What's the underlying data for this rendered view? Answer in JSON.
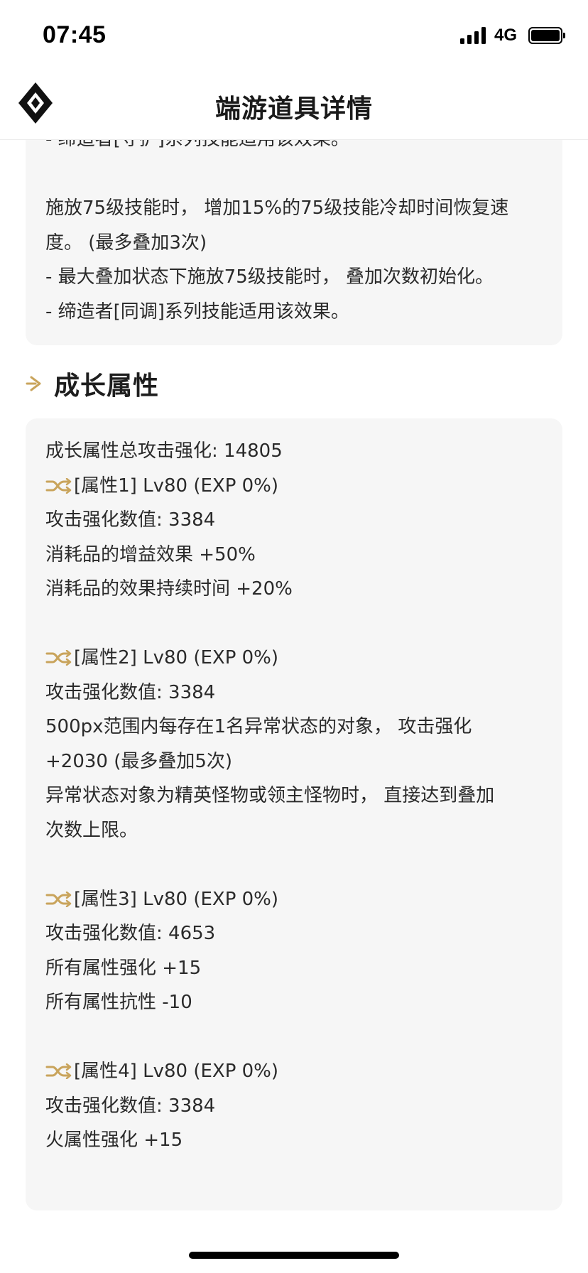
{
  "status_bar": {
    "time": "07:45",
    "network": "4G"
  },
  "header": {
    "title": "端游道具详情",
    "logo_icon": "diamond-logo-icon"
  },
  "top_card": {
    "lines": [
      "- 缔造者[守护]系列技能适用该效果。",
      "",
      "施放75级技能时， 增加15%的75级技能冷却时间恢复速",
      "度。 (最多叠加3次)",
      "- 最大叠加状态下施放75级技能时， 叠加次数初始化。",
      "- 缔造者[同调]系列技能适用该效果。"
    ]
  },
  "growth_section": {
    "title": "成长属性",
    "icon": "arrow-right-icon",
    "accent_color": "#c9a45c",
    "total": "成长属性总攻击强化: 14805",
    "attributes": [
      {
        "header": "[属性1] Lv80 (EXP 0%)",
        "lines": [
          "攻击强化数值:  3384",
          "消耗品的增益效果 +50%",
          "消耗品的效果持续时间 +20%"
        ]
      },
      {
        "header": "[属性2] Lv80 (EXP 0%)",
        "lines": [
          "攻击强化数值:  3384",
          "500px范围内每存在1名异常状态的对象，  攻击强化",
          "+2030 (最多叠加5次)",
          "异常状态对象为精英怪物或领主怪物时，  直接达到叠加",
          "次数上限。"
        ]
      },
      {
        "header": "[属性3] Lv80 (EXP 0%)",
        "lines": [
          "攻击强化数值:  4653",
          "所有属性强化 +15",
          "所有属性抗性 -10"
        ]
      },
      {
        "header": "[属性4] Lv80 (EXP 0%)",
        "lines": [
          "攻击强化数值:  3384",
          "火属性强化 +15"
        ]
      }
    ]
  }
}
